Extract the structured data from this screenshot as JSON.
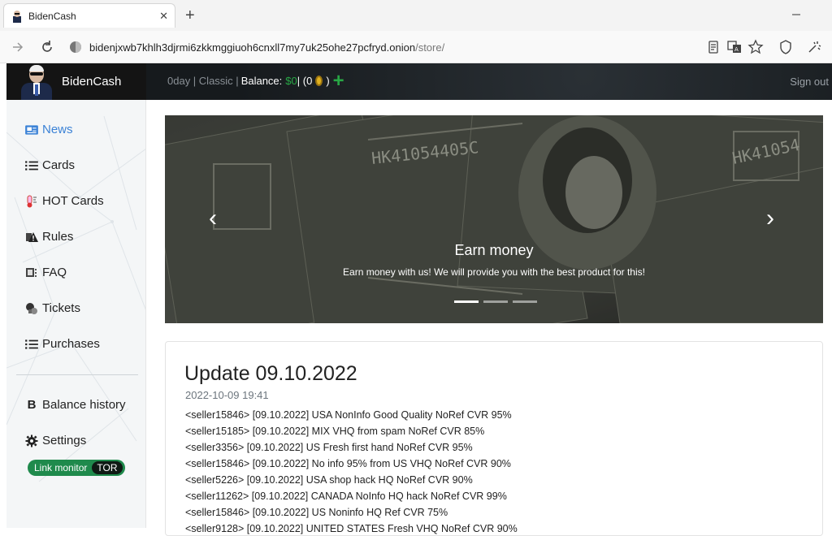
{
  "browser": {
    "tab_title": "BidenCash",
    "tab_close": "✕",
    "new_tab": "+",
    "url_host": "bidenjxwb7khlh3djrmi6zkkmggiuoh6cnxll7my7uk25ohe27pcfryd.onion",
    "url_path": "/store/"
  },
  "header": {
    "brand": "BidenCash",
    "mode": "0day | Classic | ",
    "balance_label": "Balance:",
    "balance_value": "$0",
    "coins_open": " | (0 ",
    "coins_close": ")",
    "sign_out": "Sign out"
  },
  "sidebar": {
    "items": [
      {
        "label": "News",
        "icon": "newspaper-icon"
      },
      {
        "label": "Cards",
        "icon": "list-icon"
      },
      {
        "label": "HOT Cards",
        "icon": "thermometer-icon"
      },
      {
        "label": "Rules",
        "icon": "warning-icon"
      },
      {
        "label": "FAQ",
        "icon": "faq-icon"
      },
      {
        "label": "Tickets",
        "icon": "tickets-icon"
      },
      {
        "label": "Purchases",
        "icon": "list-icon"
      },
      {
        "label": "Balance history",
        "icon": "bitcoin-icon"
      },
      {
        "label": "Settings",
        "icon": "gear-icon"
      }
    ],
    "link_monitor": "Link monitor",
    "tor": "TOR"
  },
  "carousel": {
    "title": "Earn money",
    "text": "Earn money with us! We will provide you with the best product for this!",
    "slides": 3,
    "active_slide": 1
  },
  "news": {
    "title": "Update 09.10.2022",
    "date": "2022-10-09 19:41",
    "lines": [
      "<seller15846> [09.10.2022] USA NonInfo Good Quality NoRef CVR 95%",
      "<seller15185> [09.10.2022] MIX VHQ from spam NoRef CVR 85%",
      "<seller3356> [09.10.2022] US Fresh first hand NoRef CVR 95%",
      "<seller15846> [09.10.2022] No info 95% from US VHQ NoRef CVR 90%",
      "<seller5226> [09.10.2022] USA shop hack HQ NoRef CVR 90%",
      "<seller11262> [09.10.2022] CANADA NoInfo HQ hack NoRef CVR 99%",
      "<seller15846> [09.10.2022] US Noninfo HQ Ref CVR 75%",
      "<seller9128> [09.10.2022] UNITED STATES Fresh VHQ NoRef CVR 90%"
    ]
  },
  "colors": {
    "accent": "#3b82d6",
    "success": "#28a745",
    "header_bg": "#161a1d"
  }
}
